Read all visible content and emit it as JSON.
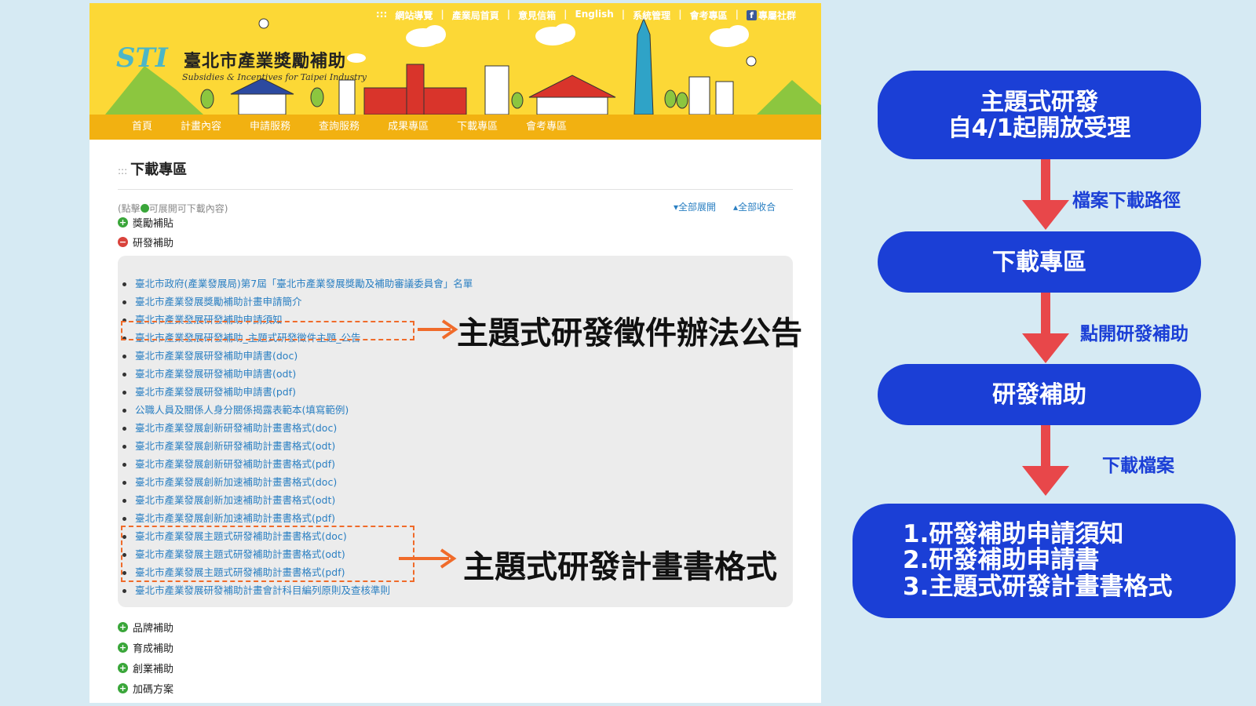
{
  "site": {
    "top_links": [
      "網站導覽",
      "產業局首頁",
      "意見信箱",
      "English",
      "系統管理",
      "會考專區",
      "專屬社群"
    ],
    "top_links_prefix": ":::",
    "facebook_icon": "facebook-icon",
    "logo_mark": "STI",
    "logo_title": "臺北市產業獎勵補助",
    "logo_subtitle": "Subsidies & Incentives for Taipei Industry",
    "nav": [
      "首頁",
      "計畫內容",
      "申請服務",
      "查詢服務",
      "成果專區",
      "下載專區",
      "會考專區"
    ]
  },
  "page": {
    "heading_prefix": ":::",
    "heading": "下載專區",
    "hint": "(點擊",
    "hint_end": "可展開可下載內容)",
    "expand_all": "全部展開",
    "collapse_all": "全部收合",
    "categories_top": [
      {
        "label": "獎勵補貼",
        "state": "collapsed"
      },
      {
        "label": "研發補助",
        "state": "expanded"
      }
    ],
    "documents": [
      "臺北市政府(產業發展局)第7屆「臺北市產業發展獎勵及補助審議委員會」名單",
      "臺北市產業發展獎勵補助計畫申請簡介",
      "臺北市產業發展研發補助申請須知",
      "臺北市產業發展研發補助_主題式研發徵件主題_公告",
      "臺北市產業發展研發補助申請書(doc)",
      "臺北市產業發展研發補助申請書(odt)",
      "臺北市產業發展研發補助申請書(pdf)",
      "公職人員及關係人身分關係揭露表範本(填寫範例)",
      "臺北市產業發展創新研發補助計畫書格式(doc)",
      "臺北市產業發展創新研發補助計畫書格式(odt)",
      "臺北市產業發展創新研發補助計畫書格式(pdf)",
      "臺北市產業發展創新加速補助計畫書格式(doc)",
      "臺北市產業發展創新加速補助計畫書格式(odt)",
      "臺北市產業發展創新加速補助計畫書格式(pdf)",
      "臺北市產業發展主題式研發補助計畫書格式(doc)",
      "臺北市產業發展主題式研發補助計畫書格式(odt)",
      "臺北市產業發展主題式研發補助計畫書格式(pdf)",
      "臺北市產業發展研發補助計畫會計科目編列原則及查核準則"
    ],
    "categories_bottom": [
      {
        "label": "品牌補助",
        "state": "collapsed"
      },
      {
        "label": "育成補助",
        "state": "collapsed"
      },
      {
        "label": "創業補助",
        "state": "collapsed"
      },
      {
        "label": "加碼方案",
        "state": "collapsed"
      }
    ]
  },
  "annotations": {
    "callout_1": "主題式研發徵件辦法公告",
    "callout_2": "主題式研發計畫書格式",
    "accent_color": "#f06b2a"
  },
  "flow": {
    "box_1_line_1": "主題式研發",
    "box_1_line_2": "自4/1起開放受理",
    "label_1": "檔案下載路徑",
    "box_2": "下載專區",
    "label_2": "點開研發補助",
    "box_3": "研發補助",
    "label_3": "下載檔案",
    "box_4_lines": [
      "1.研發補助申請須知",
      "2.研發補助申請書",
      "3.主題式研發計畫書格式"
    ],
    "box_color": "#1b3fd6",
    "arrow_color": "#e8474a"
  }
}
